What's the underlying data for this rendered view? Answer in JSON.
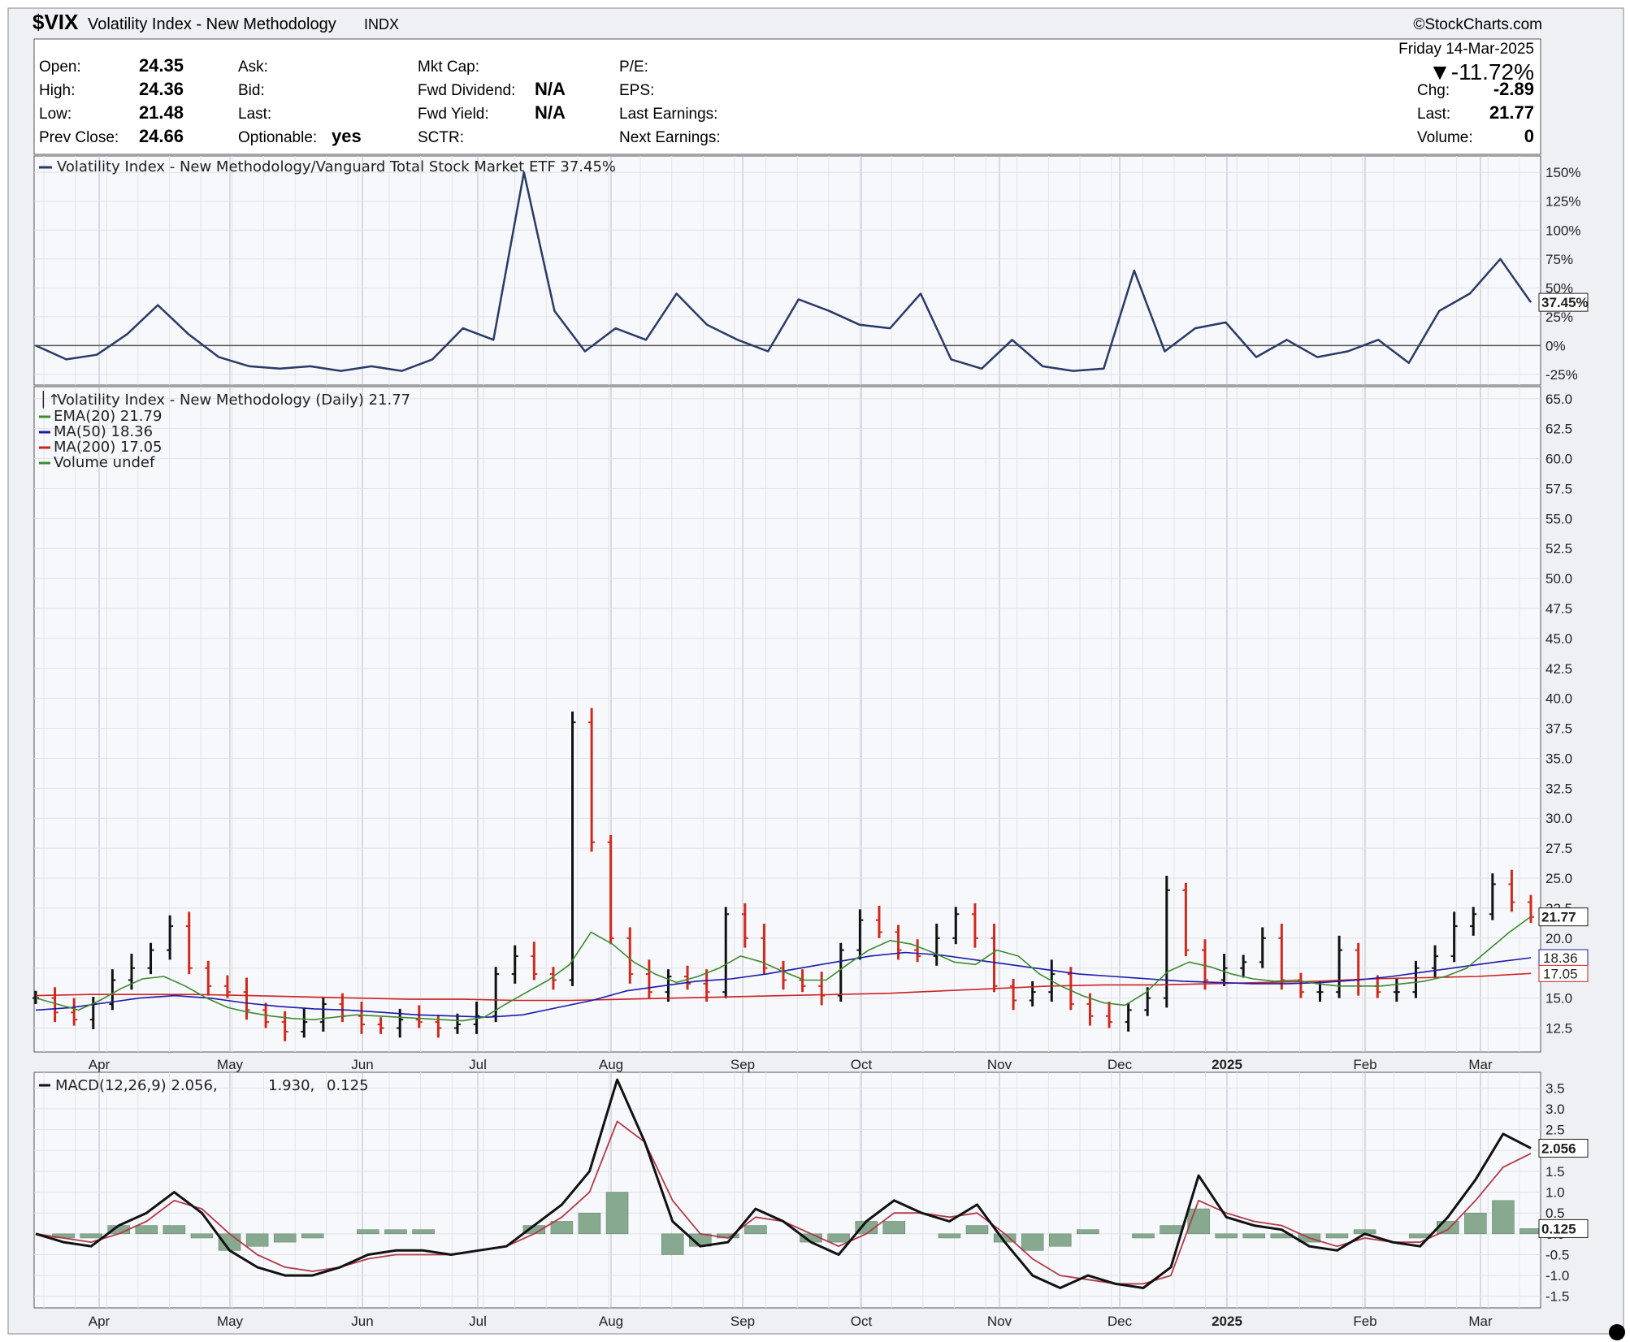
{
  "header": {
    "symbol": "$VIX",
    "name": "Volatility Index - New Methodology",
    "exchange": "INDX",
    "brand": "©StockCharts.com",
    "date": "Friday  14-Mar-2025",
    "pct_change": "▼-11.72%"
  },
  "quote": {
    "open_label": "Open:",
    "open": "24.35",
    "high_label": "High:",
    "high": "24.36",
    "low_label": "Low:",
    "low": "21.48",
    "prev_label": "Prev Close:",
    "prev": "24.66",
    "ask_label": "Ask:",
    "bid_label": "Bid:",
    "last_label": "Last:",
    "optionable_label": "Optionable:",
    "optionable": "yes",
    "mktcap_label": "Mkt Cap:",
    "fwd_div_label": "Fwd Dividend:",
    "fwd_div": "N/A",
    "fwd_yield_label": "Fwd Yield:",
    "fwd_yield": "N/A",
    "sctr_label": "SCTR:",
    "pe_label": "P/E:",
    "eps_label": "EPS:",
    "last_earn_label": "Last Earnings:",
    "next_earn_label": "Next Earnings:",
    "chg_label": "Chg:",
    "chg": "-2.89",
    "last2_label": "Last:",
    "last2": "21.77",
    "volume_label": "Volume:",
    "volume": "0"
  },
  "chart_data": [
    {
      "type": "line",
      "legend": "Volatility Index - New Methodology/Vanguard Total Stock Market ETF 37.45%",
      "last_label": "37.45%",
      "y_ticks": [
        "150%",
        "125%",
        "100%",
        "75%",
        "50%",
        "25%",
        "0%",
        "-25%"
      ],
      "ylim": [
        -30,
        160
      ],
      "x": [
        "Apr",
        "May",
        "Jun",
        "Jul",
        "Aug",
        "Sep",
        "Oct",
        "Nov",
        "Dec",
        "Jan",
        "Feb",
        "Mar"
      ],
      "values": [
        0,
        -12,
        -8,
        10,
        35,
        10,
        -10,
        -18,
        -20,
        -18,
        -22,
        -18,
        -22,
        -12,
        15,
        5,
        150,
        30,
        -5,
        15,
        5,
        45,
        18,
        5,
        -5,
        40,
        30,
        18,
        15,
        45,
        -12,
        -20,
        5,
        -18,
        -22,
        -20,
        65,
        -5,
        15,
        20,
        -10,
        5,
        -10,
        -5,
        5,
        -15,
        30,
        45,
        75,
        37.45
      ],
      "color": "#2a3a66"
    },
    {
      "type": "line",
      "legend": "Volatility Index - New Methodology (Daily) 21.77",
      "series_legends": [
        {
          "name": "EMA(20) 21.79",
          "color": "#3c8a2e"
        },
        {
          "name": "MA(50) 18.36",
          "color": "#1a1aa8"
        },
        {
          "name": "MA(200) 17.05",
          "color": "#cc2222"
        },
        {
          "name": "Volume undef",
          "color": "#3c8a2e"
        }
      ],
      "y_ticks": [
        "65.0",
        "62.5",
        "60.0",
        "57.5",
        "55.0",
        "52.5",
        "50.0",
        "47.5",
        "45.0",
        "42.5",
        "40.0",
        "37.5",
        "35.0",
        "32.5",
        "30.0",
        "27.5",
        "25.0",
        "22.5",
        "20.0",
        "17.5",
        "15.0",
        "12.5"
      ],
      "ylim": [
        10.5,
        66
      ],
      "x_labels": [
        "Apr",
        "May",
        "Jun",
        "Jul",
        "Aug",
        "Sep",
        "Oct",
        "Nov",
        "Dec",
        "2025",
        "Feb",
        "Mar"
      ],
      "price": [
        15.0,
        13.8,
        13.2,
        14.5,
        16.5,
        17.5,
        19.0,
        21.0,
        17.5,
        16.0,
        15.5,
        14.0,
        13.0,
        12.2,
        13.0,
        14.5,
        13.5,
        12.8,
        12.5,
        13.2,
        13.0,
        12.5,
        12.8,
        13.5,
        17.0,
        18.5,
        17.0,
        16.5,
        38.0,
        28.0,
        20.0,
        17.0,
        15.5,
        16.8,
        16.2,
        15.5,
        22.0,
        20.0,
        17.5,
        16.5,
        16.0,
        15.2,
        19.0,
        21.5,
        20.5,
        19.0,
        18.5,
        20.0,
        22.0,
        20.0,
        16.0,
        14.8,
        15.5,
        17.0,
        14.5,
        13.5,
        13.0,
        14.0,
        15.0,
        24.0,
        19.0,
        16.5,
        17.5,
        18.0,
        20.0,
        16.5,
        15.5,
        15.5,
        19.0,
        16.0,
        15.5,
        15.5,
        17.5,
        18.5,
        21.0,
        22.0,
        24.5,
        23.0,
        21.77
      ],
      "last_label": "21.77",
      "ema20": [
        15.0,
        14.5,
        14.0,
        14.8,
        15.8,
        16.6,
        16.8,
        16.0,
        15.0,
        14.2,
        13.8,
        13.5,
        13.3,
        13.2,
        13.4,
        13.6,
        13.5,
        13.4,
        13.3,
        13.2,
        13.1,
        13.4,
        14.5,
        15.5,
        16.5,
        17.8,
        20.5,
        19.5,
        18.0,
        17.0,
        16.3,
        16.8,
        17.5,
        18.5,
        18.0,
        17.2,
        16.5,
        16.5,
        17.8,
        19.0,
        19.8,
        19.5,
        18.8,
        18.0,
        17.8,
        19.0,
        18.5,
        17.0,
        16.0,
        15.2,
        14.6,
        14.4,
        15.5,
        17.2,
        18.0,
        17.6,
        17.0,
        16.6,
        16.4,
        16.5,
        16.2,
        16.0,
        16.0,
        16.0,
        16.2,
        16.4,
        16.8,
        17.5,
        19.0,
        20.5,
        21.79
      ],
      "ma50": [
        14.0,
        14.2,
        14.6,
        15.0,
        15.2,
        15.0,
        14.6,
        14.3,
        14.1,
        14.0,
        13.8,
        13.6,
        13.5,
        13.4,
        13.6,
        14.2,
        14.8,
        15.6,
        16.0,
        16.4,
        16.6,
        17.0,
        17.5,
        18.0,
        18.5,
        18.8,
        18.6,
        18.2,
        17.8,
        17.4,
        17.0,
        16.8,
        16.6,
        16.4,
        16.3,
        16.2,
        16.2,
        16.3,
        16.5,
        16.8,
        17.2,
        17.6,
        18.0,
        18.36
      ],
      "ma200": [
        15.2,
        15.3,
        15.3,
        15.3,
        15.2,
        15.1,
        15.0,
        14.9,
        14.9,
        14.8,
        14.8,
        14.9,
        15.0,
        15.1,
        15.2,
        15.3,
        15.4,
        15.6,
        15.8,
        16.0,
        16.1,
        16.1,
        16.2,
        16.3,
        16.4,
        16.6,
        16.7,
        16.8,
        17.05
      ]
    },
    {
      "type": "line",
      "legend_macd": "MACD(12,26,9) 2.056,",
      "legend_signal": " 1.930,",
      "legend_hist": " 0.125",
      "y_ticks": [
        "3.5",
        "3.0",
        "2.5",
        "2.0",
        "1.5",
        "1.0",
        "0.5",
        "0.0",
        "-0.5",
        "-1.0",
        "-1.5"
      ],
      "ylim": [
        -1.7,
        3.8
      ],
      "x_labels": [
        "Apr",
        "May",
        "Jun",
        "Jul",
        "Aug",
        "Sep",
        "Oct",
        "Nov",
        "Dec",
        "2025",
        "Feb",
        "Mar"
      ],
      "macd": [
        0.0,
        -0.2,
        -0.3,
        0.2,
        0.5,
        1.0,
        0.5,
        -0.4,
        -0.8,
        -1.0,
        -1.0,
        -0.8,
        -0.5,
        -0.4,
        -0.4,
        -0.5,
        -0.4,
        -0.3,
        0.2,
        0.7,
        1.5,
        3.7,
        2.2,
        0.3,
        -0.3,
        -0.2,
        0.6,
        0.3,
        -0.2,
        -0.5,
        0.3,
        0.8,
        0.5,
        0.3,
        0.7,
        -0.2,
        -1.0,
        -1.3,
        -1.0,
        -1.2,
        -1.3,
        -0.8,
        1.4,
        0.4,
        0.2,
        0.1,
        -0.3,
        -0.4,
        0.0,
        -0.2,
        -0.3,
        0.4,
        1.3,
        2.4,
        2.056
      ],
      "signal": [
        0.0,
        -0.1,
        -0.2,
        0.0,
        0.3,
        0.8,
        0.6,
        0.0,
        -0.5,
        -0.8,
        -0.9,
        -0.8,
        -0.6,
        -0.5,
        -0.5,
        -0.5,
        -0.4,
        -0.3,
        0.0,
        0.4,
        1.0,
        2.7,
        2.2,
        0.8,
        0.0,
        -0.1,
        0.4,
        0.3,
        0.0,
        -0.3,
        0.0,
        0.5,
        0.5,
        0.4,
        0.5,
        0.0,
        -0.6,
        -1.0,
        -1.1,
        -1.2,
        -1.2,
        -1.0,
        0.8,
        0.5,
        0.3,
        0.2,
        -0.1,
        -0.3,
        -0.1,
        -0.2,
        -0.2,
        0.1,
        0.8,
        1.6,
        1.93
      ],
      "histogram": [
        0.0,
        -0.1,
        -0.1,
        0.2,
        0.2,
        0.2,
        -0.1,
        -0.4,
        -0.3,
        -0.2,
        -0.1,
        0.0,
        0.1,
        0.1,
        0.1,
        0.0,
        0.0,
        0.0,
        0.2,
        0.3,
        0.5,
        1.0,
        0.0,
        -0.5,
        -0.3,
        -0.1,
        0.2,
        0.0,
        -0.2,
        -0.2,
        0.3,
        0.3,
        0.0,
        -0.1,
        0.2,
        -0.2,
        -0.4,
        -0.3,
        0.1,
        0.0,
        -0.1,
        0.2,
        0.6,
        -0.1,
        -0.1,
        -0.1,
        -0.2,
        -0.1,
        0.1,
        0.0,
        -0.1,
        0.3,
        0.5,
        0.8,
        0.125
      ],
      "last_label": "2.056",
      "hist_label": "0.125"
    }
  ]
}
